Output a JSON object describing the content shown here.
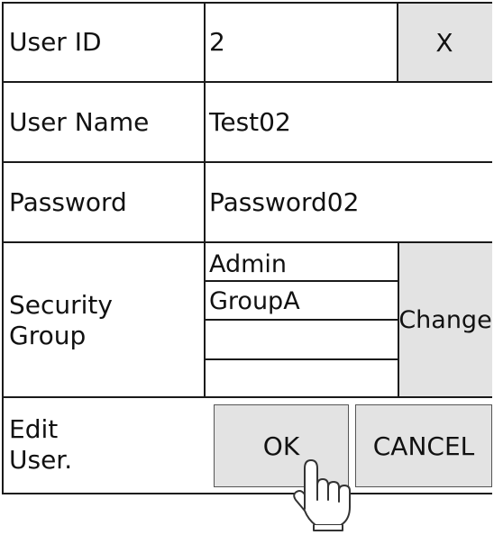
{
  "rows": {
    "user_id": {
      "label": "User ID",
      "value": "2",
      "close_button": "X"
    },
    "user_name": {
      "label": "User Name",
      "value": "Test02"
    },
    "password": {
      "label": "Password",
      "value": "Password02"
    },
    "security_group": {
      "label": "Security\nGroup",
      "groups": [
        "Admin",
        "GroupA",
        "",
        ""
      ],
      "change_button": "Change"
    },
    "footer": {
      "label": "Edit\nUser.",
      "ok_button": "OK",
      "cancel_button": "CANCEL"
    }
  },
  "icons": {
    "pointer": "pointing-hand-icon"
  },
  "colors": {
    "button_bg": "#e3e3e3",
    "border": "#1a1a1a"
  }
}
